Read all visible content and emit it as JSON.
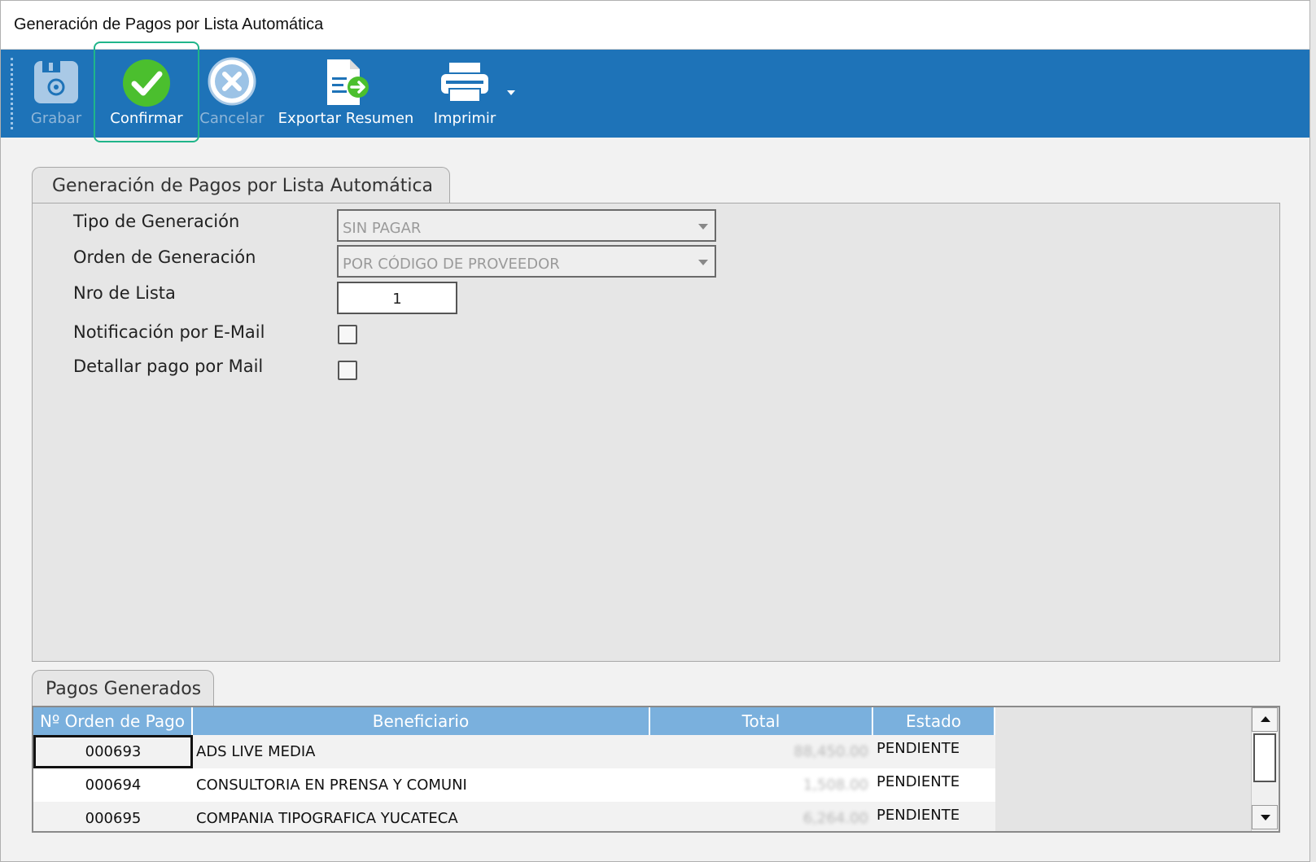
{
  "window": {
    "title": "Generación de Pagos por Lista Automática"
  },
  "toolbar": {
    "grabar": "Grabar",
    "confirmar": "Confirmar",
    "cancelar": "Cancelar",
    "exportar": "Exportar Resumen",
    "imprimir": "Imprimir",
    "icons": {
      "grabar": "save-icon",
      "confirmar": "check-circle-icon",
      "cancelar": "cancel-circle-icon",
      "exportar": "export-document-icon",
      "imprimir": "printer-icon"
    },
    "colors": {
      "bar": "#1e73b8",
      "confirm": "#4bbf2e",
      "selected_outline": "#20b58a"
    }
  },
  "form": {
    "tab_label": "Generación de Pagos por Lista Automática",
    "tipo_label": "Tipo de Generación",
    "tipo_value": "SIN PAGAR",
    "orden_label": "Orden de Generación",
    "orden_value": "POR CÓDIGO DE PROVEEDOR",
    "lista_label": "Nro de Lista",
    "lista_value": "1",
    "notif_label": "Notificación por E-Mail",
    "notif_checked": false,
    "detallar_label": "Detallar pago por Mail",
    "detallar_checked": false
  },
  "pagos": {
    "tab_label": "Pagos Generados",
    "columns": [
      "Nº Orden de Pago",
      "Beneficiario",
      "Total",
      "Estado"
    ],
    "rows": [
      {
        "orden": "000693",
        "beneficiario": "ADS LIVE MEDIA",
        "total": "88,450.00",
        "estado": "PENDIENTE"
      },
      {
        "orden": "000694",
        "beneficiario": "CONSULTORIA EN PRENSA Y COMUNI",
        "total": "1,508.00",
        "estado": "PENDIENTE"
      },
      {
        "orden": "000695",
        "beneficiario": "COMPANIA TIPOGRAFICA YUCATECA",
        "total": "6,264.00",
        "estado": "PENDIENTE"
      }
    ]
  }
}
